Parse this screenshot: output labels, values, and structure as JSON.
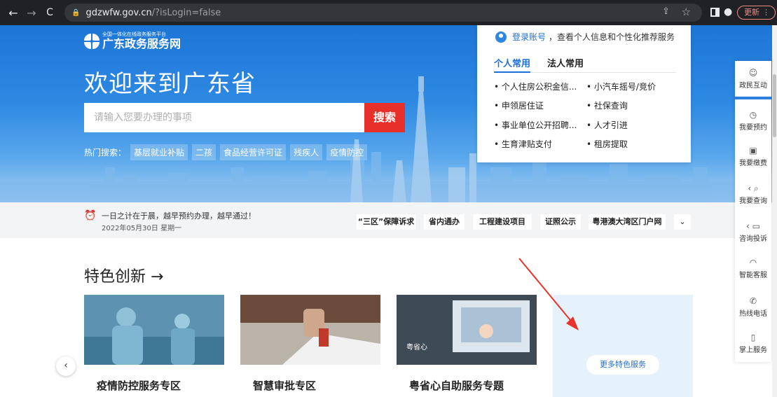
{
  "browser": {
    "url_host": "gdzwfw.gov.cn",
    "url_path": "/?isLogin=false",
    "update_label": "更新"
  },
  "site": {
    "logo_sub": "全国一体化在线政务服务平台",
    "logo_main": "广东政务服务网",
    "welcome": "欢迎来到广东省",
    "search_placeholder": "请输入您要办理的事项",
    "search_button": "搜索",
    "hot_label": "热门搜索：",
    "hot_tags": [
      "基层就业补贴",
      "二孩",
      "食品经营许可证",
      "残疾人",
      "疫情防控"
    ]
  },
  "login_card": {
    "login_link": "登录账号",
    "login_text": "，查看个人信息和个性化推荐服务",
    "tabs": [
      "个人常用",
      "法人常用"
    ],
    "services": [
      "个人住房公积金信...",
      "小汽车摇号/竞价",
      "申领居住证",
      "社保查询",
      "事业单位公开招聘...",
      "人才引进",
      "生育津贴支付",
      "租房提取"
    ]
  },
  "float_bar": {
    "items": [
      "政民互动",
      "我要预约",
      "我要缴费",
      "我要查询",
      "咨询投诉",
      "智能客服",
      "热线电话",
      "掌上服务"
    ]
  },
  "notice": {
    "slogan": "一日之计在于晨，越早预约办理，越早通过！",
    "date": "2022年05月30日 星期一",
    "links": [
      "“三区”保障诉求",
      "省内通办",
      "工程建设项目",
      "证照公示",
      "粤港澳大湾区门户网"
    ]
  },
  "features": {
    "title": "特色创新 →",
    "cards": [
      {
        "title": "疫情防控服务专区",
        "desc": "..."
      },
      {
        "title": "智慧审批专区",
        "desc": "..."
      },
      {
        "title": "粤省心自助服务专题",
        "desc": "..."
      }
    ],
    "watermark": "粤省心",
    "more_button": "更多特色服务"
  },
  "colors": {
    "brand_blue": "#1f6fd6",
    "search_red": "#e8302b",
    "annotation_red": "#e8322c"
  }
}
